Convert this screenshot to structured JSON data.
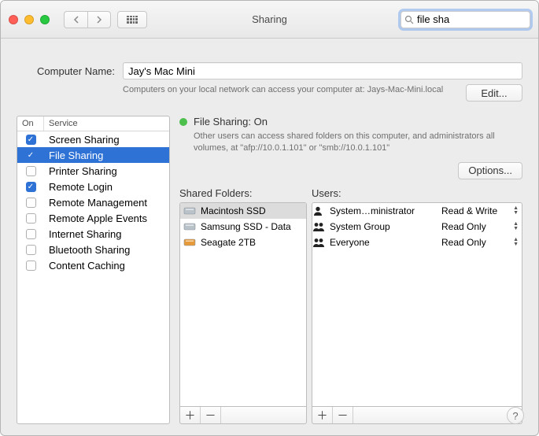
{
  "title": "Sharing",
  "search": {
    "value": "file sha"
  },
  "computerName": {
    "label": "Computer Name:",
    "value": "Jay's Mac Mini",
    "desc": "Computers on your local network can access your computer at: Jays-Mac-Mini.local",
    "editLabel": "Edit..."
  },
  "serviceHeader": {
    "on": "On",
    "service": "Service"
  },
  "services": [
    {
      "label": "Screen Sharing",
      "checked": true,
      "selected": false
    },
    {
      "label": "File Sharing",
      "checked": true,
      "selected": true
    },
    {
      "label": "Printer Sharing",
      "checked": false,
      "selected": false
    },
    {
      "label": "Remote Login",
      "checked": true,
      "selected": false
    },
    {
      "label": "Remote Management",
      "checked": false,
      "selected": false
    },
    {
      "label": "Remote Apple Events",
      "checked": false,
      "selected": false
    },
    {
      "label": "Internet Sharing",
      "checked": false,
      "selected": false
    },
    {
      "label": "Bluetooth Sharing",
      "checked": false,
      "selected": false
    },
    {
      "label": "Content Caching",
      "checked": false,
      "selected": false
    }
  ],
  "status": {
    "title": "File Sharing: On",
    "desc": "Other users can access shared folders on this computer, and administrators all volumes, at \"afp://10.0.1.101\" or \"smb://10.0.1.101\""
  },
  "optionsLabel": "Options...",
  "foldersLabel": "Shared Folders:",
  "usersLabel": "Users:",
  "folders": [
    {
      "name": "Macintosh SSD",
      "color": "#b9c2c9",
      "selected": true
    },
    {
      "name": "Samsung SSD - Data",
      "color": "#b9c2c9",
      "selected": false
    },
    {
      "name": "Seagate 2TB",
      "color": "#e69a3a",
      "selected": false
    }
  ],
  "users": [
    {
      "name": "System…ministrator",
      "icon": "single",
      "perm": "Read & Write"
    },
    {
      "name": "System Group",
      "icon": "group",
      "perm": "Read Only"
    },
    {
      "name": "Everyone",
      "icon": "group",
      "perm": "Read Only"
    }
  ]
}
